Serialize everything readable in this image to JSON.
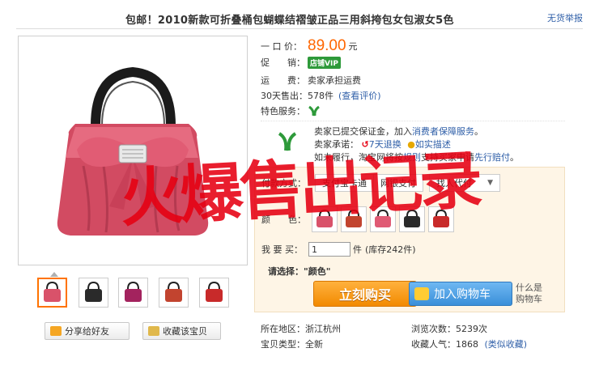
{
  "header": {
    "title": "包邮！2010新款可折叠桶包蝴蝶结褶皱正品三用斜挎包女包淑女5色",
    "report_link": "无货举报"
  },
  "gallery": {
    "thumbnails": [
      {
        "color": "#d9526a",
        "active": true
      },
      {
        "color": "#2a2a2a",
        "active": false
      },
      {
        "color": "#a3235e",
        "active": false
      },
      {
        "color": "#c2442f",
        "active": false
      },
      {
        "color": "#c82a2a",
        "active": false
      }
    ]
  },
  "actions": {
    "share_label": "分享给好友",
    "favorite_label": "收藏该宝贝"
  },
  "info": {
    "price_label": "一 口 价：",
    "price": "89.00",
    "price_unit": "元",
    "promo_label": "促　　销：",
    "promo_badge": "店铺VIP",
    "shipping_label": "运　　费：",
    "shipping_value": "卖家承担运费",
    "sold_label": "30天售出：",
    "sold_value": "578件",
    "sold_link": "(查看评价)",
    "service_label": "特色服务："
  },
  "services": {
    "line1_prefix": "卖家已提交保证金，加入",
    "line1_link": "消费者保障服务",
    "line1_suffix": "。",
    "line2_prefix": "卖家承诺：",
    "line2_item1": "7天退换",
    "line2_item2": "如实描述",
    "line3_prefix": "如未履行，淘宝网将按",
    "line3_link1": "规则",
    "line3_mid": "支持买家申请",
    "line3_link2": "先行赔付",
    "line3_suffix": "。"
  },
  "panel": {
    "pay_label": "付款方式：",
    "pay_tabs": [
      "支付宝卡通",
      "网银支付"
    ],
    "pay_select": "找人代付",
    "color_label": "颜　　色：",
    "swatches": [
      "#d9526a",
      "#c2442f",
      "#e05a74",
      "#2a2a2a",
      "#c82a2a"
    ],
    "qty_label": "我 要 买：",
    "qty_value": "1",
    "qty_unit": "件",
    "stock_text": "(库存242件)",
    "pick_hint": "请选择：\"颜色\"",
    "buy_label": "立刻购买",
    "cart_label": "加入购物车",
    "what_cart": "什么是购物车"
  },
  "meta": {
    "region_label": "所在地区：",
    "region_value": "浙江杭州",
    "views_label": "浏览次数：",
    "views_value": "5239次",
    "condition_label": "宝贝类型：",
    "condition_value": "全新",
    "popularity_label": "收藏人气：",
    "popularity_value": "1868",
    "popularity_link": "(类似收藏)"
  },
  "watermark": {
    "text": "火爆售出记录",
    "color": "#e60012"
  }
}
